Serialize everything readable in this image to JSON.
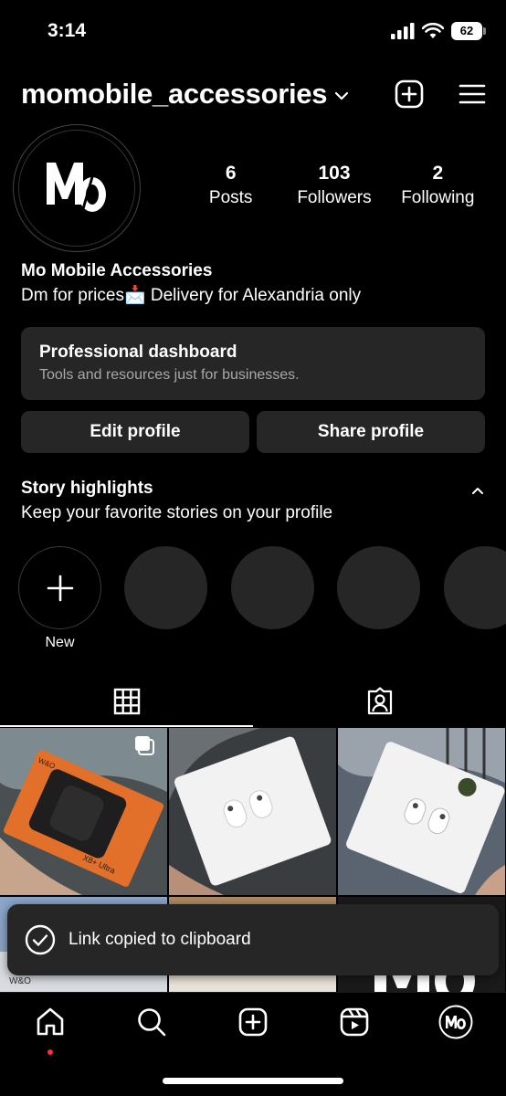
{
  "status_bar": {
    "time": "3:14",
    "battery": "62"
  },
  "header": {
    "username": "momobile_accessories"
  },
  "profile": {
    "avatar_letters": "MO",
    "stats": [
      {
        "value": "6",
        "label": "Posts"
      },
      {
        "value": "103",
        "label": "Followers"
      },
      {
        "value": "2",
        "label": "Following"
      }
    ],
    "display_name": "Mo Mobile Accessories",
    "bio": "Dm for prices📩 Delivery for Alexandria only"
  },
  "dashboard": {
    "title": "Professional dashboard",
    "subtitle": "Tools and resources just for businesses."
  },
  "buttons": {
    "edit": "Edit profile",
    "share": "Share profile"
  },
  "highlights": {
    "title": "Story highlights",
    "subtitle": "Keep your favorite stories on your profile",
    "new_label": "New"
  },
  "posts": [
    {
      "brand": "W&O",
      "product": "X8+ Ultra",
      "type": "carousel"
    },
    {
      "product": "AirPods box"
    },
    {
      "product": "AirPods box"
    },
    {
      "brand": "W&O"
    },
    {
      "product": ""
    },
    {
      "logo": "Mo"
    }
  ],
  "toast": {
    "text": "Link copied to clipboard"
  },
  "nav_avatar": "MO"
}
